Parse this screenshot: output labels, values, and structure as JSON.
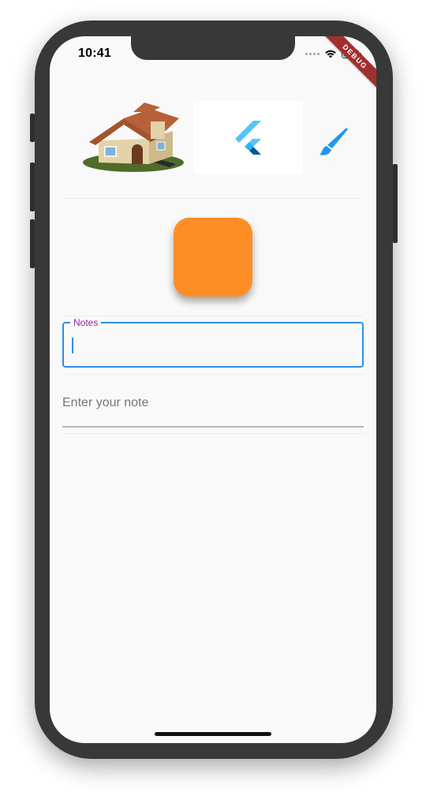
{
  "status_bar": {
    "time": "10:41",
    "debug_banner": "DEBUG"
  },
  "images": {
    "house": "house-illustration",
    "flutter_logo": "flutter-logo",
    "brush_icon": "brush-icon"
  },
  "orange_box": {
    "color": "#fd8e26"
  },
  "notes_field": {
    "label": "Notes",
    "value": "",
    "accent_color": "#2e8ee8",
    "label_color": "#8e2a9b"
  },
  "note_input": {
    "placeholder": "Enter your note",
    "value": ""
  }
}
